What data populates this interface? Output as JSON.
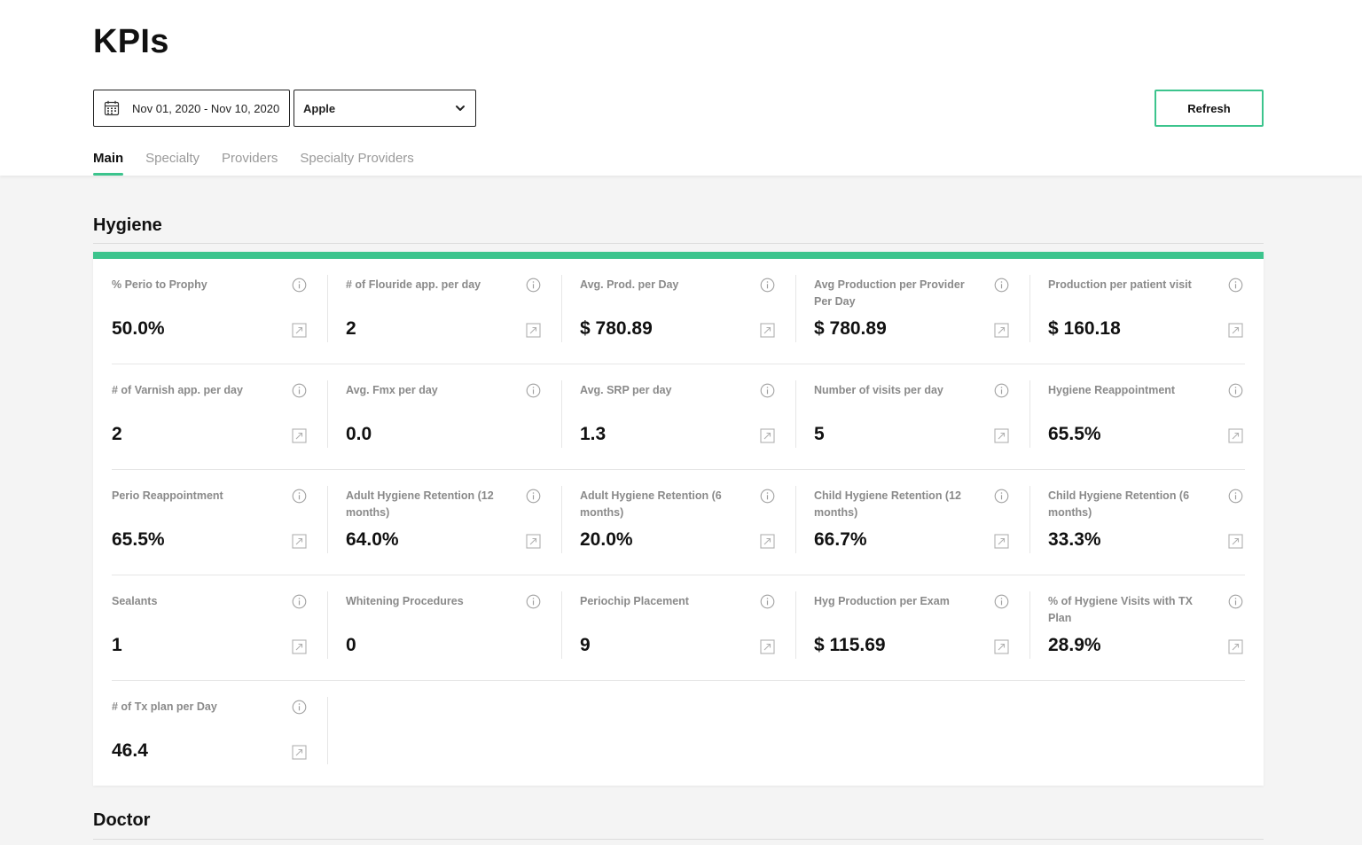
{
  "page": {
    "title": "KPIs"
  },
  "filters": {
    "date_range": "Nov 01, 2020 - Nov 10, 2020",
    "date_icon": "calendar-icon",
    "location_selected": "Apple",
    "location_icon": "chevron-down-icon",
    "refresh_label": "Refresh"
  },
  "tabs": [
    {
      "label": "Main",
      "active": true
    },
    {
      "label": "Specialty",
      "active": false
    },
    {
      "label": "Providers",
      "active": false
    },
    {
      "label": "Specialty Providers",
      "active": false
    }
  ],
  "colors": {
    "accent": "#3cc48d",
    "muted_text": "#8a8a8a",
    "background": "#f4f4f4"
  },
  "sections": {
    "hygiene": {
      "title": "Hygiene",
      "kpis": [
        {
          "label": "% Perio to Prophy",
          "value": "50.0%",
          "expand": true
        },
        {
          "label": "# of Flouride app. per day",
          "value": "2",
          "expand": true
        },
        {
          "label": "Avg. Prod. per Day",
          "value": "$ 780.89",
          "expand": true
        },
        {
          "label": "Avg Production per Provider Per Day",
          "value": "$ 780.89",
          "expand": true
        },
        {
          "label": "Production per patient visit",
          "value": "$ 160.18",
          "expand": true
        },
        {
          "label": "# of Varnish app. per day",
          "value": "2",
          "expand": true
        },
        {
          "label": "Avg. Fmx per day",
          "value": "0.0",
          "expand": false
        },
        {
          "label": "Avg. SRP per day",
          "value": "1.3",
          "expand": true
        },
        {
          "label": "Number of visits per day",
          "value": "5",
          "expand": true
        },
        {
          "label": "Hygiene Reappointment",
          "value": "65.5%",
          "expand": true
        },
        {
          "label": "Perio Reappointment",
          "value": "65.5%",
          "expand": true
        },
        {
          "label": "Adult Hygiene Retention (12 months)",
          "value": "64.0%",
          "expand": true
        },
        {
          "label": "Adult Hygiene Retention (6 months)",
          "value": "20.0%",
          "expand": true
        },
        {
          "label": "Child Hygiene Retention (12 months)",
          "value": "66.7%",
          "expand": true
        },
        {
          "label": "Child Hygiene Retention (6 months)",
          "value": "33.3%",
          "expand": true
        },
        {
          "label": "Sealants",
          "value": "1",
          "expand": true
        },
        {
          "label": "Whitening Procedures",
          "value": "0",
          "expand": false
        },
        {
          "label": "Periochip Placement",
          "value": "9",
          "expand": true
        },
        {
          "label": "Hyg Production per Exam",
          "value": "$ 115.69",
          "expand": true
        },
        {
          "label": "% of Hygiene Visits with TX Plan",
          "value": "28.9%",
          "expand": true
        },
        {
          "label": "# of Tx plan per Day",
          "value": "46.4",
          "expand": true
        }
      ],
      "info_icon": "info-icon",
      "expand_icon": "expand-arrow-icon"
    },
    "doctor": {
      "title": "Doctor"
    }
  }
}
